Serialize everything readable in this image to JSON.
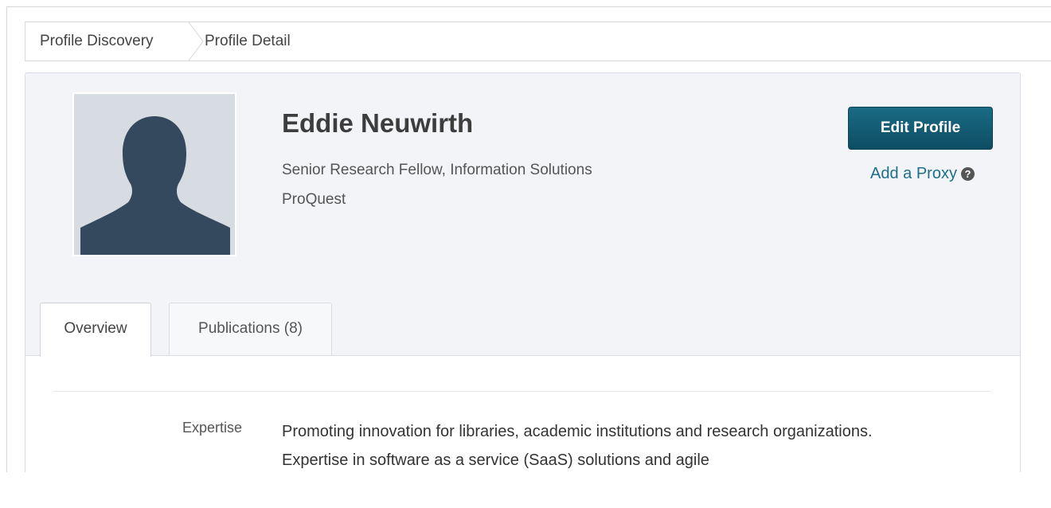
{
  "breadcrumb": {
    "items": [
      "Profile Discovery",
      "Profile Detail"
    ]
  },
  "profile": {
    "name": "Eddie Neuwirth",
    "title": "Senior Research Fellow, Information Solutions",
    "organization": "ProQuest"
  },
  "actions": {
    "edit_label": "Edit Profile",
    "proxy_label": "Add a Proxy",
    "help_icon": "question-circle-icon"
  },
  "tabs": [
    {
      "label": "Overview",
      "active": true
    },
    {
      "label": "Publications (8)",
      "active": false
    }
  ],
  "overview": {
    "expertise_label": "Expertise",
    "expertise_text": "Promoting innovation for libraries, academic institutions and research organizations.  Expertise in software as a service (SaaS) solutions and agile"
  },
  "colors": {
    "accent": "#1a6b85",
    "link": "#1d6f8a",
    "card_bg": "#f2f4f7",
    "avatar_bg": "#d7dce3",
    "silhouette": "#34495e"
  }
}
